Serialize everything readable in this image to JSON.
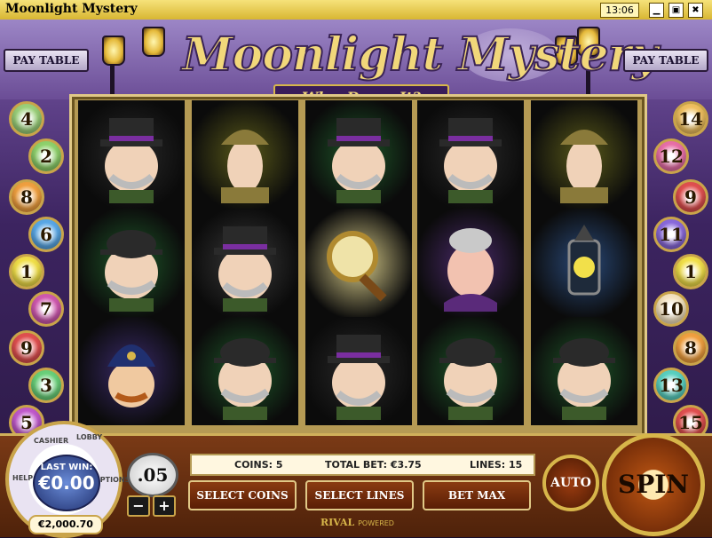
{
  "window": {
    "title": "Moonlight Mystery",
    "clock": "13:06",
    "minimize_glyph": "▁",
    "restore_glyph": "▣",
    "close_glyph": "✖"
  },
  "header": {
    "logo": "Moonlight Mystery",
    "subtitle": "Who•Dunn•It?",
    "paytable_left": "PAY TABLE",
    "paytable_right": "PAY TABLE"
  },
  "lines_left": [
    {
      "num": "4",
      "color": "#9bd07a"
    },
    {
      "num": "2",
      "color": "#8fd16c"
    },
    {
      "num": "8",
      "color": "#f0a040"
    },
    {
      "num": "6",
      "color": "#5aa8e6"
    },
    {
      "num": "1",
      "color": "#f2e04a"
    },
    {
      "num": "7",
      "color": "#d05ab0"
    },
    {
      "num": "9",
      "color": "#e05050"
    },
    {
      "num": "3",
      "color": "#6ad07a"
    },
    {
      "num": "5",
      "color": "#c05acb"
    }
  ],
  "lines_right": [
    {
      "num": "14",
      "color": "#f0c060"
    },
    {
      "num": "12",
      "color": "#e870a8"
    },
    {
      "num": "9",
      "color": "#e05050"
    },
    {
      "num": "11",
      "color": "#8a6adb"
    },
    {
      "num": "1",
      "color": "#f2e04a"
    },
    {
      "num": "10",
      "color": "#f4e3c0"
    },
    {
      "num": "8",
      "color": "#f0a040"
    },
    {
      "num": "13",
      "color": "#5ad0c0"
    },
    {
      "num": "15",
      "color": "#e05050"
    }
  ],
  "reels": [
    [
      {
        "sym": "tophat-detective",
        "bg": "#2a2a2a"
      },
      {
        "sym": "bowler-inspector",
        "bg": "#1f5a2a"
      },
      {
        "sym": "constable",
        "bg": "#3a2a6a"
      }
    ],
    [
      {
        "sym": "sherlock",
        "bg": "#5a5a1a"
      },
      {
        "sym": "tophat-detective",
        "bg": "#3a3a3a"
      },
      {
        "sym": "bowler-inspector",
        "bg": "#1f5a2a"
      }
    ],
    [
      {
        "sym": "tophat-detective",
        "bg": "#1f5a2a"
      },
      {
        "sym": "magnifying-glass",
        "bg": "#d8cc8a"
      },
      {
        "sym": "tophat-detective",
        "bg": "#2a2a2a"
      }
    ],
    [
      {
        "sym": "tophat-detective",
        "bg": "#2a2a2a"
      },
      {
        "sym": "old-lady",
        "bg": "#4a2a6a"
      },
      {
        "sym": "bowler-inspector",
        "bg": "#1f5a2a"
      }
    ],
    [
      {
        "sym": "sherlock",
        "bg": "#5a5a1a"
      },
      {
        "sym": "lantern",
        "bg": "#2a4a7a"
      },
      {
        "sym": "bowler-inspector",
        "bg": "#1f5a2a"
      }
    ]
  ],
  "dial": {
    "cashier": "CASHIER",
    "lobby": "LOBBY",
    "help": "HELP",
    "options": "OPTIONS",
    "last_win_label": "LAST WIN:",
    "last_win_value": "€0.00"
  },
  "balance": "€2,000.70",
  "coin_value": ".05",
  "minus": "−",
  "plus": "+",
  "info": {
    "coins": "COINS: 5",
    "total_bet": "TOTAL BET: €3.75",
    "lines": "LINES: 15"
  },
  "buttons": {
    "select_coins": "SELECT COINS",
    "select_lines": "SELECT LINES",
    "bet_max": "BET MAX",
    "auto": "AUTO",
    "spin": "SPIN"
  },
  "brand": {
    "name": "RIVAL",
    "powered": "POWERED"
  },
  "colors": {
    "gold": "#d7b64a",
    "panel": "#5a1e05"
  }
}
